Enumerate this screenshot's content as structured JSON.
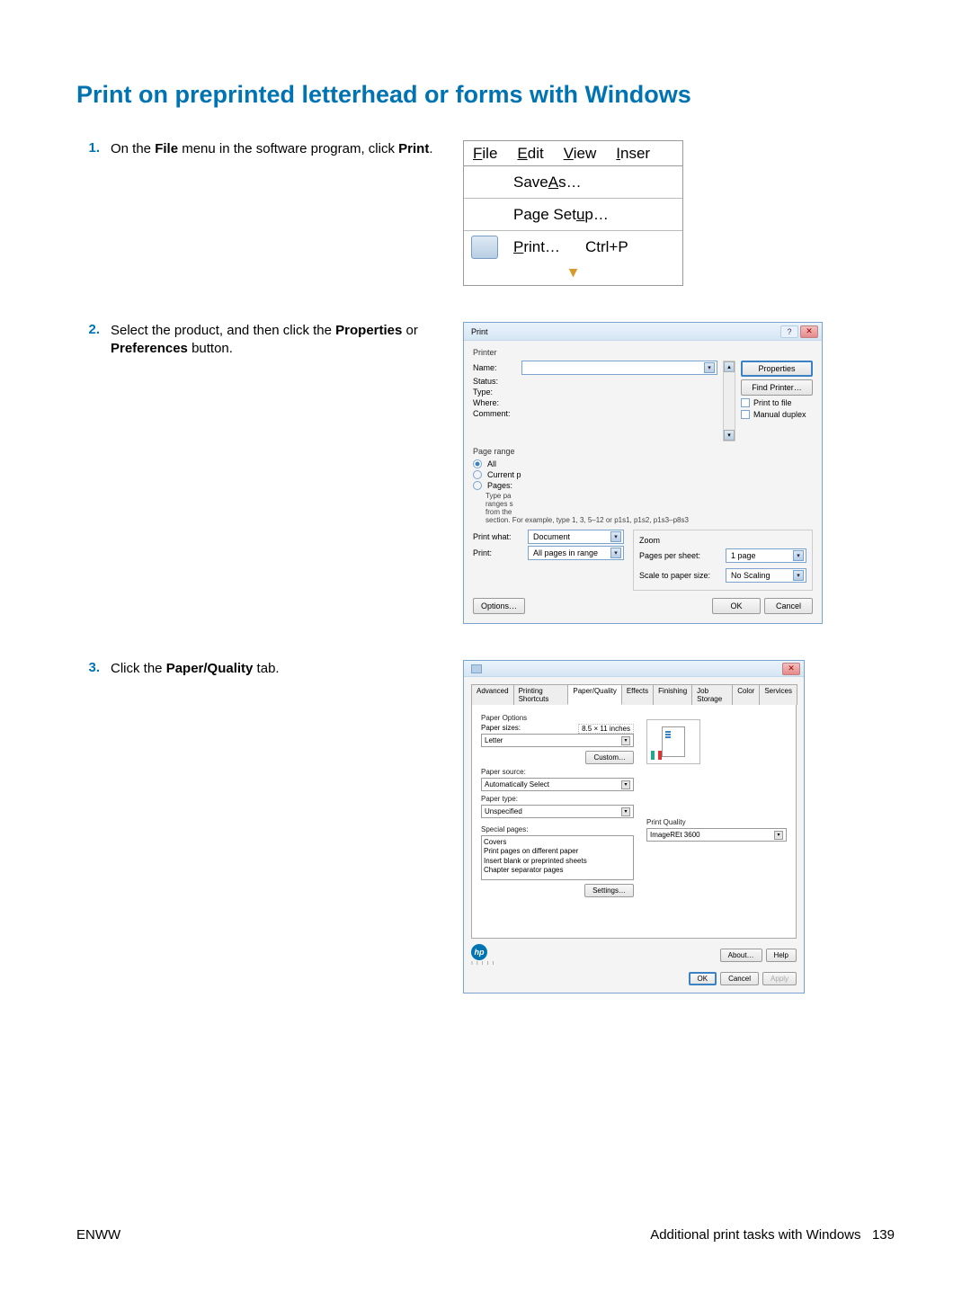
{
  "heading": "Print on preprinted letterhead or forms with Windows",
  "steps": [
    {
      "num": "1.",
      "text_before": "On the ",
      "bold1": "File",
      "text_mid": " menu in the software program, click ",
      "bold2": "Print",
      "text_after": "."
    },
    {
      "num": "2.",
      "text_before": "Select the product, and then click the ",
      "bold1": "Properties",
      "text_mid": " or ",
      "bold2": "Preferences",
      "text_after": " button."
    },
    {
      "num": "3.",
      "text_before": "Click the ",
      "bold1": "Paper/Quality",
      "text_mid": " tab.",
      "bold2": "",
      "text_after": ""
    }
  ],
  "fig1": {
    "menu": [
      "File",
      "Edit",
      "View",
      "Inser"
    ],
    "save_as": "Save As…",
    "page_setup": "Page Setup…",
    "print": "Print…",
    "shortcut": "Ctrl+P"
  },
  "fig2": {
    "title": "Print",
    "printer_label": "Printer",
    "name": "Name:",
    "status": "Status:",
    "type": "Type:",
    "where": "Where:",
    "comment": "Comment:",
    "properties": "Properties",
    "find_printer": "Find Printer…",
    "print_to_file": "Print to file",
    "manual_duplex": "Manual duplex",
    "page_range": "Page range",
    "all": "All",
    "current": "Current p",
    "pages": "Pages:",
    "type_hint": "Type pa\nranges s\nfrom the",
    "range_hint": "section. For example, type 1, 3, 5–12 or p1s1, p1s2, p1s3–p8s3",
    "print_what": "Print what:",
    "print_what_val": "Document",
    "print_sel": "Print:",
    "print_sel_val": "All pages in range",
    "zoom": "Zoom",
    "pps": "Pages per sheet:",
    "pps_val": "1 page",
    "scale": "Scale to paper size:",
    "scale_val": "No Scaling",
    "options": "Options…",
    "ok": "OK",
    "cancel": "Cancel"
  },
  "fig3": {
    "tabs": [
      "Advanced",
      "Printing Shortcuts",
      "Paper/Quality",
      "Effects",
      "Finishing",
      "Job Storage",
      "Color",
      "Services"
    ],
    "active_tab": "Paper/Quality",
    "paper_options": "Paper Options",
    "paper_sizes": "Paper sizes:",
    "paper_sizes_dim": "8.5 × 11 inches",
    "paper_sizes_val": "Letter",
    "custom": "Custom…",
    "paper_source": "Paper source:",
    "paper_source_val": "Automatically Select",
    "paper_type": "Paper type:",
    "paper_type_val": "Unspecified",
    "special_pages": "Special pages:",
    "special_list": [
      "Covers",
      "Print pages on different paper",
      "Insert blank or preprinted sheets",
      "Chapter separator pages"
    ],
    "settings": "Settings…",
    "print_quality": "Print Quality",
    "print_quality_val": "ImageREt 3600",
    "about": "About…",
    "help": "Help",
    "ok": "OK",
    "cancel": "Cancel",
    "apply": "Apply"
  },
  "footer": {
    "left": "ENWW",
    "right_text": "Additional print tasks with Windows",
    "page_num": "139"
  }
}
